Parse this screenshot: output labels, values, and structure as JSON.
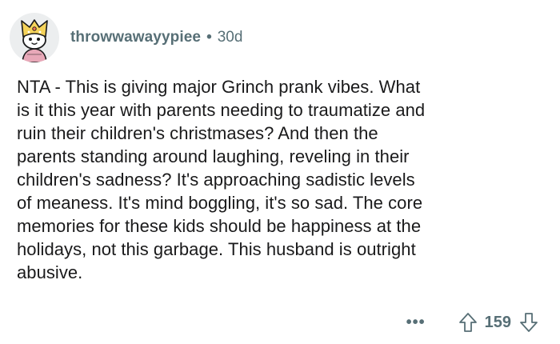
{
  "comment": {
    "author": "throwwawayypiee",
    "separator": "•",
    "age": "30d",
    "text": "NTA - This is giving major Grinch prank vibes. What\nis it this year with parents needing to traumatize and\nruin their children's christmases? And then the\nparents standing around laughing, reveling in their\nchildren's sadness? It's approaching sadistic levels\nof meaness. It's mind boggling, it's so sad. The core\nmemories for these kids should be happiness at the\nholidays, not this garbage. This husband is outright\nabusive.",
    "more_label": "•••",
    "score": "159"
  },
  "icons": {
    "avatar": "snoo-avatar",
    "upvote": "upvote-arrow-icon",
    "downvote": "downvote-arrow-icon",
    "more": "more-options-icon"
  },
  "colors": {
    "text": "#1a1a1b",
    "meta": "#576f76",
    "avatar_bg": "#eceeef",
    "hat": "#f5d35a",
    "shirt": "#e8a8b8"
  }
}
